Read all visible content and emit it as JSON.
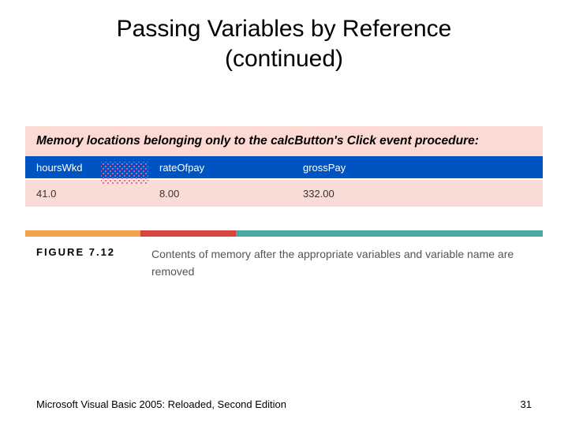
{
  "title_line1": "Passing Variables by Reference",
  "title_line2": "(continued)",
  "banner": "Memory locations belonging only to the calcButton's Click event procedure:",
  "headers": {
    "c1": "hoursWkd",
    "c2": "rateOfpay",
    "c3": "grossPay"
  },
  "values": {
    "c1": "41.0",
    "c2": "8.00",
    "c3": "332.00"
  },
  "figure_label": "FIGURE 7.12",
  "figure_caption": "Contents of memory after the appropriate variables and variable name are removed",
  "footer_left": "Microsoft Visual Basic 2005: Reloaded, Second Edition",
  "footer_right": "31"
}
